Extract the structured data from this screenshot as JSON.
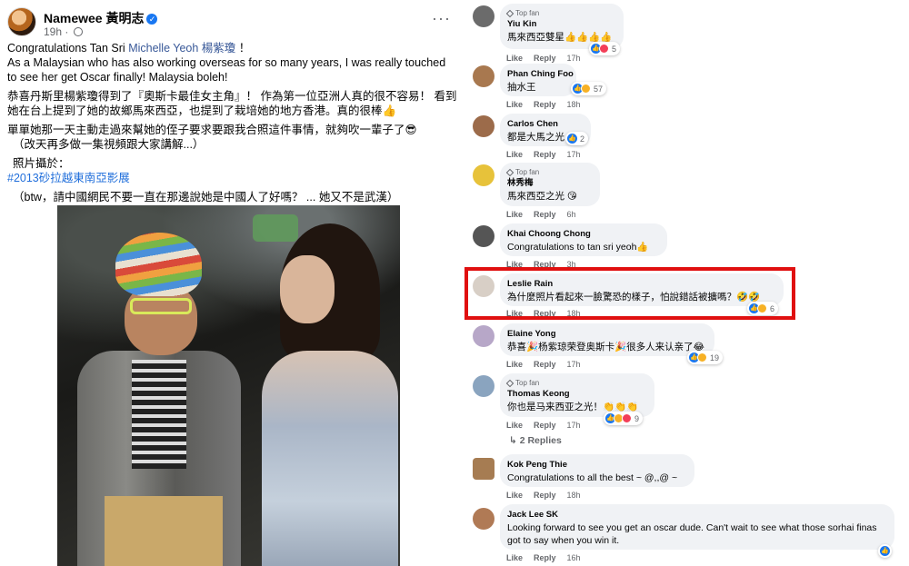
{
  "post": {
    "author": "Namewee 黃明志",
    "time": "19h",
    "more_label": "···",
    "lines": {
      "congrats_prefix": "Congratulations Tan Sri ",
      "congrats_link": "Michelle Yeoh 楊紫瓊",
      "congrats_suffix": " ！",
      "line2": "As a Malaysian who has also working overseas for so many years, I was really touched to see her get Oscar finally! Malaysia boleh!",
      "line3": "恭喜丹斯里楊紫瓊得到了『奧斯卡最佳女主角』！ 作為第一位亞洲人真的很不容易！ 看到她在台上提到了她的故鄉馬來西亞，也提到了栽培她的地方香港。真的很棒👍",
      "line4": "單單她那一天主動走過來幫她的侄子要求要跟我合照這件事情，就夠吹一輩子了😎",
      "line5": "（改天再多做一集視頻跟大家講解...）",
      "line6": "照片攝於：",
      "hashtag": "#2013砂拉越東南亞影展",
      "line7": "（btw，請中國網民不要一直在那邊說她是中國人了好嗎？ ... 她又不是武漢）"
    }
  },
  "labels": {
    "like": "Like",
    "reply": "Reply",
    "top_fan": "Top fan"
  },
  "comments": [
    {
      "name": "Yiu Kin",
      "text": "馬來西亞雙星👍👍👍👍",
      "time": "17h",
      "top_fan": true,
      "reacts": "5"
    },
    {
      "name": "Phan Ching Foo",
      "text": "抽水王",
      "time": "18h",
      "reacts": "57"
    },
    {
      "name": "Carlos Chen",
      "text": "都是大馬之光",
      "time": "17h",
      "reacts": "2"
    },
    {
      "name": "林秀梅",
      "text": "馬來西亞之光 😘",
      "time": "6h",
      "top_fan": true
    },
    {
      "name": "Khai Choong Chong",
      "text": "Congratulations to tan sri yeoh👍",
      "time": "3h"
    },
    {
      "name": "Leslie Rain",
      "text": "為什麼照片看起來一臉驚恐的樣子，怕說錯話被擴嗎？🤣🤣",
      "time": "18h",
      "reacts": "6"
    },
    {
      "name": "Elaine Yong",
      "text": "恭喜🎉杨紫琼荣登奥斯卡🎉很多人来认亲了😂",
      "time": "17h",
      "reacts": "19"
    },
    {
      "name": "Thomas Keong",
      "text": "你也是马来西亚之光！👏👏👏",
      "time": "17h",
      "top_fan": true,
      "reacts": "9"
    },
    {
      "name": "Kok Peng Thie",
      "text": "Congratulations to all the best ~ @,,@ ~",
      "time": "18h"
    },
    {
      "name": "Jack Lee SK",
      "text": "Looking forward to see you get an oscar dude. Can't wait to see what those sorhai finas got to say when you win it.",
      "time": "16h"
    }
  ],
  "replies_label": "2 Replies",
  "colors": {
    "highlight": "#e01010",
    "link": "#385898",
    "hashtag": "#216fdb"
  }
}
